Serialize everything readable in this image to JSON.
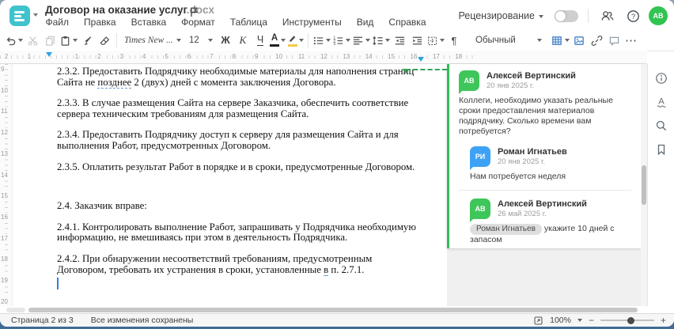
{
  "window": {
    "bg_accent": "#3f6b94",
    "logo_color": "#3fc3cd"
  },
  "header": {
    "title": "Договор на оказание услуг",
    "title_ext": ".docx",
    "menu": [
      "Файл",
      "Правка",
      "Вставка",
      "Формат",
      "Таблица",
      "Инструменты",
      "Вид",
      "Справка"
    ],
    "review_label": "Рецензирование",
    "review_toggle": "off",
    "avatar_initials": "АВ"
  },
  "toolbar": {
    "font_name": "Times New ...",
    "font_size": "12",
    "bold_label": "Ж",
    "italic_label": "К",
    "underline_label": "Ч",
    "font_color_label": "А",
    "style_name": "Обычный",
    "pilcrow": "¶",
    "more_label": "⋯"
  },
  "ruler": {
    "h_margin_numbers": [
      "2",
      "1"
    ],
    "h_numbers": [
      "1",
      "2",
      "3",
      "4",
      "5",
      "6",
      "7",
      "8",
      "9",
      "10",
      "11",
      "12",
      "13",
      "14",
      "15",
      "16",
      "17",
      "18"
    ],
    "v_numbers": [
      "9",
      "10",
      "11",
      "12",
      "13",
      "14",
      "15",
      "16",
      "17",
      "18",
      "19",
      "20"
    ]
  },
  "document": {
    "paragraphs": [
      {
        "runs": [
          {
            "t": "2.3.2. Предоставить Подрядчику необходимые материалы для наполнения страниц Сайта не "
          },
          {
            "t": "позднее",
            "u": true
          },
          {
            "t": " 2 (двух) дней с момента заключения Договора."
          }
        ]
      },
      {
        "runs": [
          {
            "t": "2.3.3. В случае размещения Сайта на сервере Заказчика, обеспечить соответствие сервера техническим требованиям для размещения Сайта."
          }
        ]
      },
      {
        "runs": [
          {
            "t": "2.3.4. Предоставить Подрядчику доступ к серверу для размещения Сайта и для выполнения Работ, предусмотренных Договором."
          }
        ]
      },
      {
        "runs": [
          {
            "t": "2.3.5. Оплатить результат Работ в порядке и в сроки, предусмотренные Договором."
          }
        ]
      },
      {
        "gap": true,
        "runs": [
          {
            "t": "2.4. Заказчик вправе:"
          }
        ]
      },
      {
        "runs": [
          {
            "t": "2.4.1. Контролировать выполнение Работ, запрашивать у Подрядчика необходимую информацию, не вмешиваясь при этом в деятельность Подрядчика."
          }
        ]
      },
      {
        "runs": [
          {
            "t": "2.4.2. При обнаружении несоответствий требованиям, предусмотренным Договором, требовать их устранения в сроки, установленные "
          },
          {
            "t": "в",
            "u": true
          },
          {
            "t": " п. 2.7.1."
          }
        ]
      }
    ]
  },
  "comments": {
    "items": [
      {
        "initials": "АВ",
        "color": "#3fc65a",
        "name": "Алексей Вертинский",
        "date": "20 янв 2025 г.",
        "text": "Коллеги, необходимо указать реальные сроки предоставления материалов подрядчику. Сколько времени вам потребуется?"
      },
      {
        "initials": "РИ",
        "color": "#3da2f5",
        "name": "Роман Игнатьев",
        "date": "20 янв 2025 г.",
        "text": "Нам потребуется неделя",
        "reply": true
      },
      {
        "initials": "АВ",
        "color": "#3fc65a",
        "name": "Алексей Вертинский",
        "date": "26 май 2025 г.",
        "mention": "Роман Игнатьев",
        "text": "укажите 10 дней с запасом",
        "reply": true,
        "divider": true
      }
    ]
  },
  "statusbar": {
    "page_info": "Страница 2 из 3",
    "saved_info": "Все изменения сохранены",
    "zoom_value": "100%",
    "zoom_minus": "−",
    "zoom_plus": "+"
  }
}
